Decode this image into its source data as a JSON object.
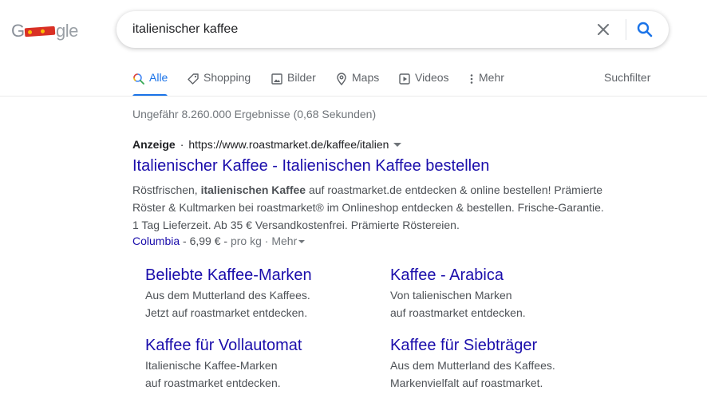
{
  "header": {
    "logo_text": "Google",
    "search_value": "italienischer kaffee"
  },
  "tabs": [
    {
      "label": "Alle",
      "icon": "search-icon",
      "active": true
    },
    {
      "label": "Shopping",
      "icon": "tag-icon",
      "active": false
    },
    {
      "label": "Bilder",
      "icon": "image-icon",
      "active": false
    },
    {
      "label": "Maps",
      "icon": "map-pin-icon",
      "active": false
    },
    {
      "label": "Videos",
      "icon": "play-icon",
      "active": false
    },
    {
      "label": "Mehr",
      "icon": "more-vert-icon",
      "active": false
    }
  ],
  "filter_label": "Suchfilter",
  "stats": "Ungefähr 8.260.000 Ergebnisse (0,68 Sekunden)",
  "ad": {
    "label": "Anzeige",
    "dot": "·",
    "url": "https://www.roastmarket.de/kaffee/italien",
    "title": "Italienischer Kaffee - Italienischen Kaffee bestellen",
    "desc_pre": "Röstfrischen, ",
    "desc_bold": "italienischen Kaffee",
    "desc_post": " auf roastmarket.de entdecken & online bestellen! Prämierte Röster & Kultmarken bei roastmarket® im Onlineshop entdecken & bestellen. Frische-Garantie. 1 Tag Lieferzeit. Ab 35 € Versandkostenfrei. Prämierte Röstereien.",
    "ext_link": "Columbia",
    "ext_price": " - 6,99 € - ",
    "ext_unit": "pro kg",
    "ext_sep": " · ",
    "ext_more": "Mehr"
  },
  "sitelinks": [
    {
      "title": "Beliebte Kaffee-Marken",
      "line1": "Aus dem Mutterland des Kaffees.",
      "line2": "Jetzt auf roastmarket entdecken."
    },
    {
      "title": "Kaffee - Arabica",
      "line1": "Von talienischen Marken",
      "line2": "auf roastmarket entdecken."
    },
    {
      "title": "Kaffee für Vollautomat",
      "line1": "Italienische Kaffee-Marken",
      "line2": "auf roastmarket entdecken."
    },
    {
      "title": "Kaffee für Siebträger",
      "line1": "Aus dem Mutterland des Kaffees.",
      "line2": "Markenvielfalt auf roastmarket."
    }
  ],
  "colors": {
    "link": "#1a0dab",
    "accent": "#1a73e8",
    "muted": "#70757a",
    "text": "#4d5156"
  }
}
